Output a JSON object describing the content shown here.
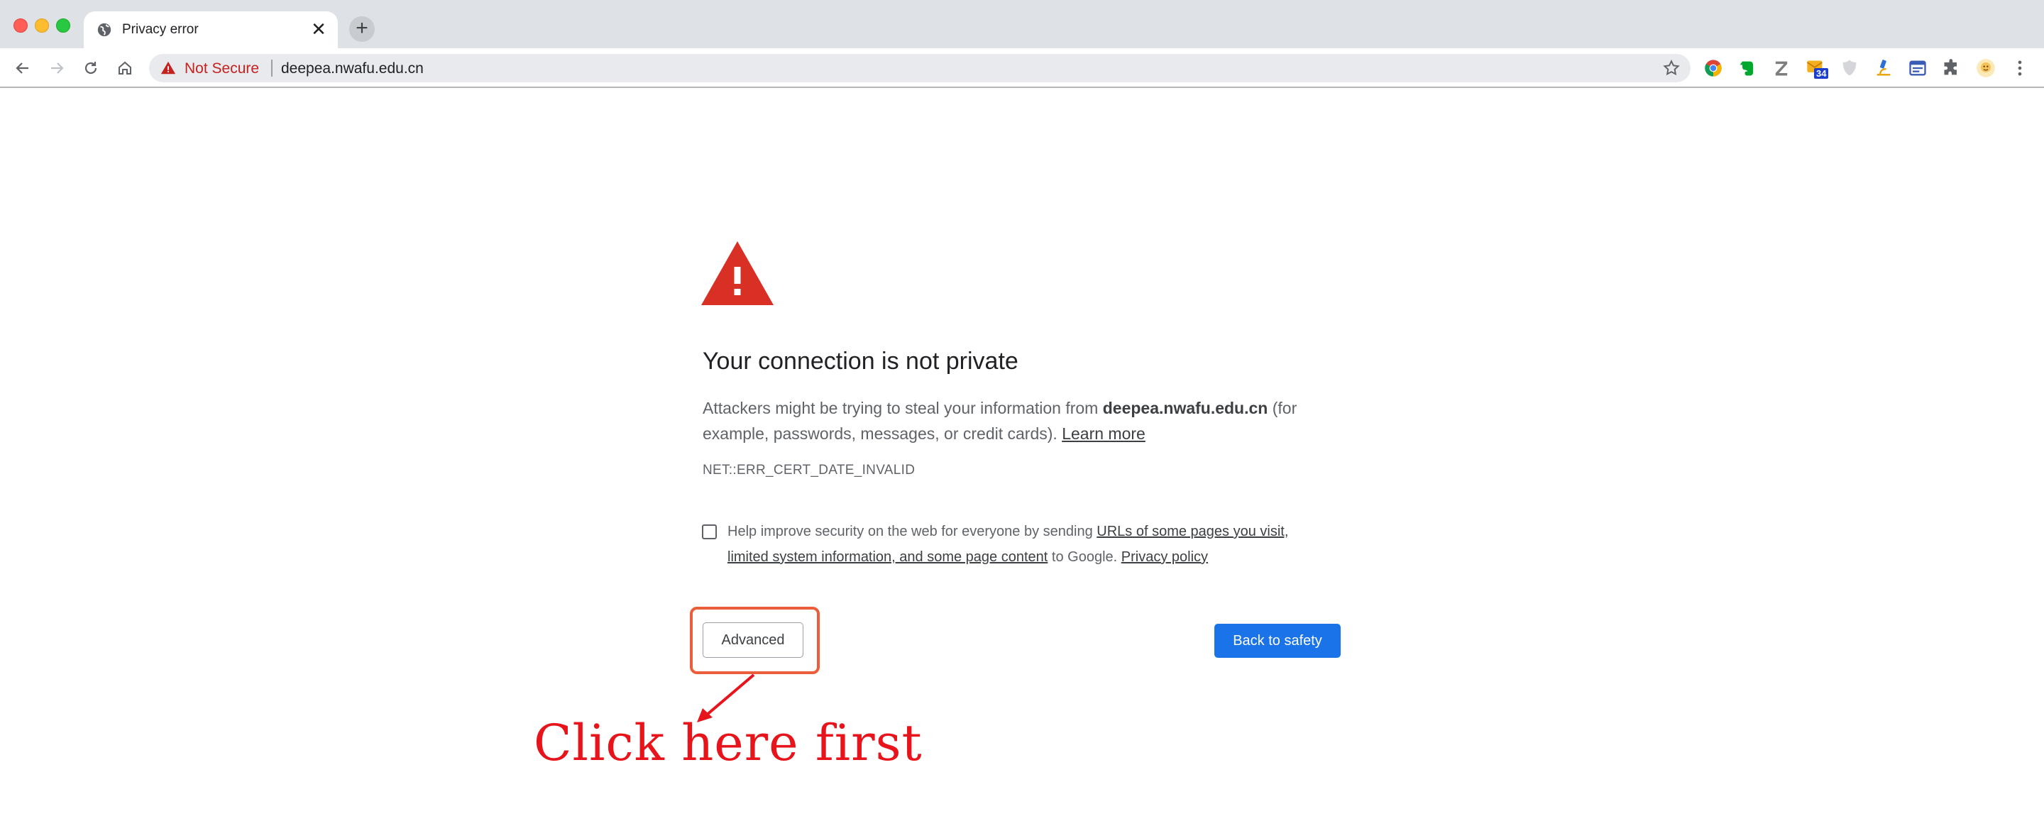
{
  "window": {
    "tab_title": "Privacy error",
    "tab_close": "✕",
    "new_tab": "+"
  },
  "toolbar": {
    "security_label": "Not Secure",
    "url": "deepea.nwafu.edu.cn",
    "extensions": [
      "chrome-icon",
      "evernote-icon",
      "zotero-icon",
      "mail-badge-icon",
      "shield-icon",
      "microscope-icon",
      "window-icon",
      "puzzle-icon",
      "avatar"
    ],
    "mail_badge": "34"
  },
  "interstitial": {
    "heading": "Your connection is not private",
    "msg_before": "Attackers might be trying to steal your information from ",
    "msg_domain": "deepea.nwafu.edu.cn",
    "msg_after": " (for example, passwords, messages, or credit cards). ",
    "learn_more": "Learn more",
    "error_code": "NET::ERR_CERT_DATE_INVALID",
    "optin_before": "Help improve security on the web for everyone by sending ",
    "optin_link": "URLs of some pages you visit, limited system information, and some page content",
    "optin_middle": " to Google. ",
    "privacy_policy": "Privacy policy",
    "advanced_button": "Advanced",
    "back_button": "Back to safety"
  },
  "annotation": {
    "text": "Click here first",
    "color": "#e8141c"
  },
  "colors": {
    "accent": "#1a73e8",
    "warning": "#d93025",
    "insecure_text": "#c5221f"
  }
}
